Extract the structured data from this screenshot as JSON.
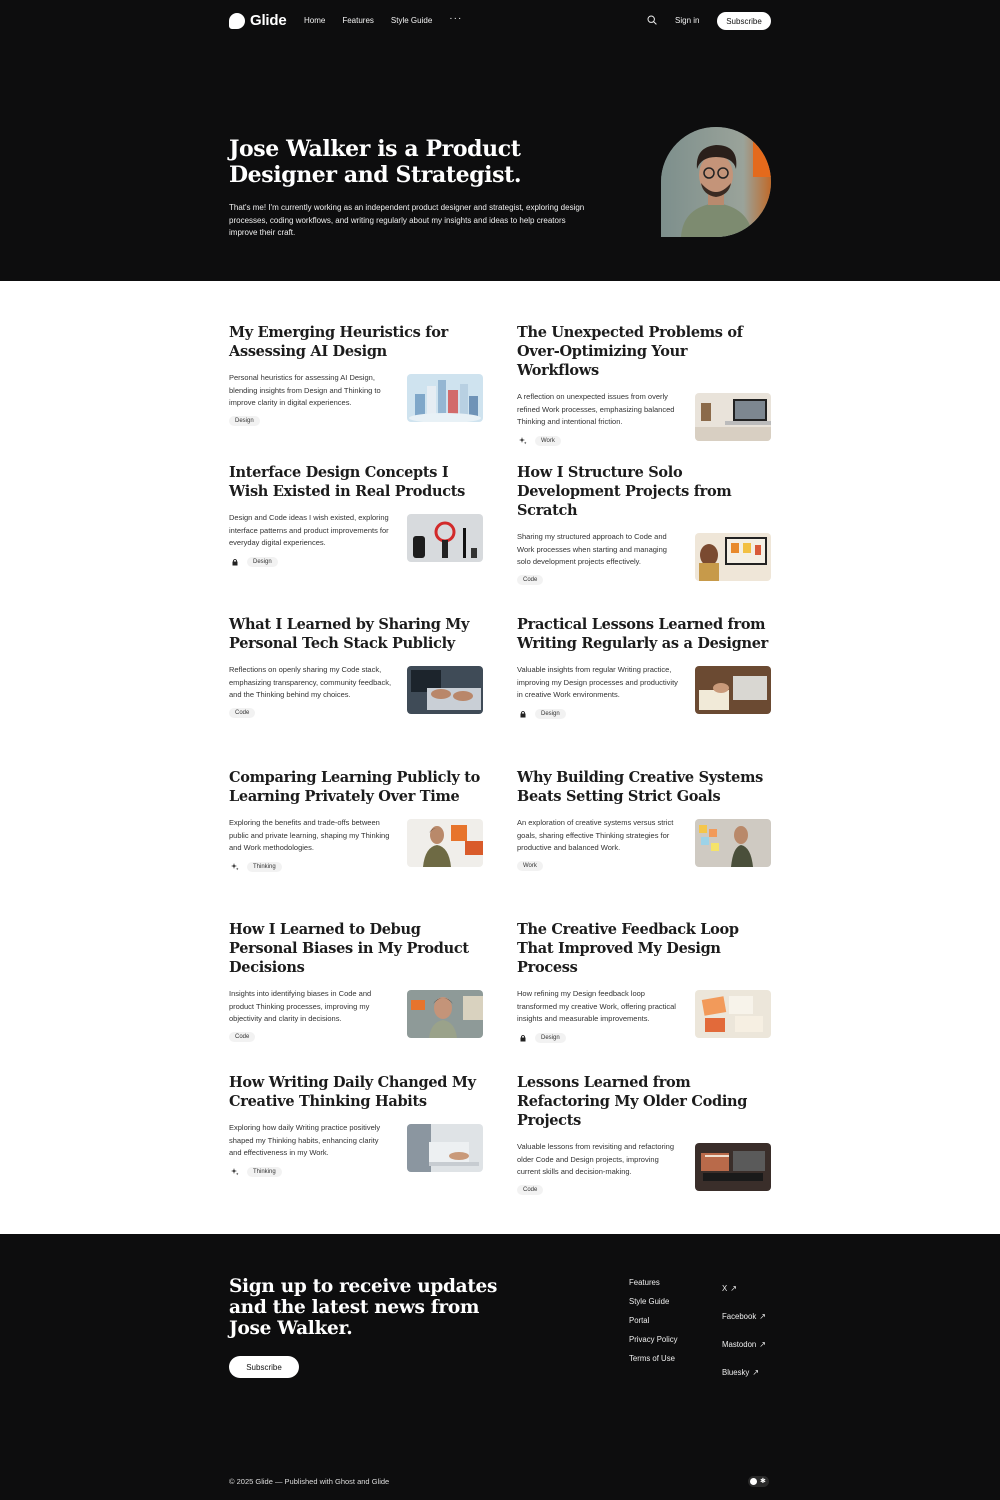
{
  "header": {
    "brand": "Glide",
    "nav": [
      "Home",
      "Features",
      "Style Guide"
    ],
    "more": "···",
    "signin": "Sign in",
    "subscribe": "Subscribe"
  },
  "hero": {
    "title": "Jose Walker is a Product Designer and Strategist.",
    "subtitle": "That's me! I'm currently working as an independent product designer and strategist, exploring design processes, coding workflows, and writing regularly about my insights and ideas to help creators improve their craft."
  },
  "posts": [
    {
      "title": "My Emerging Heuristics for Assessing AI Design",
      "excerpt": "Personal heuristics for assessing AI Design, blending insights from Design and Thinking to improve clarity in digital experiences.",
      "tag": "Design",
      "icon": "",
      "thumb": "city-model"
    },
    {
      "title": "The Unexpected Problems of Over-Optimizing Your Workflows",
      "excerpt": "A reflection on unexpected issues from overly refined Work processes, emphasizing balanced Thinking and intentional friction.",
      "tag": "Work",
      "icon": "sparkle-icon",
      "thumb": "desk-laptop"
    },
    {
      "title": "Interface Design Concepts I Wish Existed in Real Products",
      "excerpt": "Design and Code ideas I wish existed, exploring interface patterns and product improvements for everyday digital experiences.",
      "tag": "Design",
      "icon": "lock-icon",
      "thumb": "speaker-devices"
    },
    {
      "title": "How I Structure Solo Development Projects from Scratch",
      "excerpt": "Sharing my structured approach to Code and Work processes when starting and managing solo development projects effectively.",
      "tag": "Code",
      "icon": "",
      "thumb": "woman-monitor"
    },
    {
      "title": "What I Learned by Sharing My Personal Tech Stack Publicly",
      "excerpt": "Reflections on openly sharing my Code stack, emphasizing transparency, community feedback, and the Thinking behind my choices.",
      "tag": "Code",
      "icon": "",
      "thumb": "hands-keyboard"
    },
    {
      "title": "Practical Lessons Learned from Writing Regularly as a Designer",
      "excerpt": "Valuable insights from regular Writing practice, improving my Design processes and productivity in creative Work environments.",
      "tag": "Design",
      "icon": "lock-icon",
      "thumb": "writing-laptop"
    },
    {
      "title": "Comparing Learning Publicly to Learning Privately Over Time",
      "excerpt": "Exploring the benefits and trade-offs between public and private learning, shaping my Thinking and Work methodologies.",
      "tag": "Thinking",
      "icon": "sparkle-icon",
      "thumb": "man-orange"
    },
    {
      "title": "Why Building Creative Systems Beats Setting Strict Goals",
      "excerpt": "An exploration of creative systems versus strict goals, sharing effective Thinking strategies for productive and balanced Work.",
      "tag": "Work",
      "icon": "",
      "thumb": "man-notes"
    },
    {
      "title": "How I Learned to Debug Personal Biases in My Product Decisions",
      "excerpt": "Insights into identifying biases in Code and product Thinking processes, improving my objectivity and clarity in decisions.",
      "tag": "Code",
      "icon": "",
      "thumb": "man-glasses"
    },
    {
      "title": "The Creative Feedback Loop That Improved My Design Process",
      "excerpt": "How refining my Design feedback loop transformed my creative Work, offering practical insights and measurable improvements.",
      "tag": "Design",
      "icon": "lock-icon",
      "thumb": "design-papers"
    },
    {
      "title": "How Writing Daily Changed My Creative Thinking Habits",
      "excerpt": "Exploring how daily Writing practice positively shaped my Thinking habits, enhancing clarity and effectiveness in my Work.",
      "tag": "Thinking",
      "icon": "sparkle-icon",
      "thumb": "laptop-typing"
    },
    {
      "title": "Lessons Learned from Refactoring My Older Coding Projects",
      "excerpt": "Valuable lessons from revisiting and refactoring older Code and Design projects, improving current skills and decision-making.",
      "tag": "Code",
      "icon": "",
      "thumb": "studio-dark"
    }
  ],
  "footer": {
    "title": "Sign up to receive updates and the latest news from Jose Walker.",
    "subscribe": "Subscribe",
    "links": [
      "Features",
      "Style Guide",
      "Portal",
      "Privacy Policy",
      "Terms of Use"
    ],
    "socials": [
      "X",
      "Facebook",
      "Mastodon",
      "Bluesky"
    ],
    "arrow": "↗",
    "copyright": "© 2025 Glide — Published with Ghost and Glide"
  }
}
